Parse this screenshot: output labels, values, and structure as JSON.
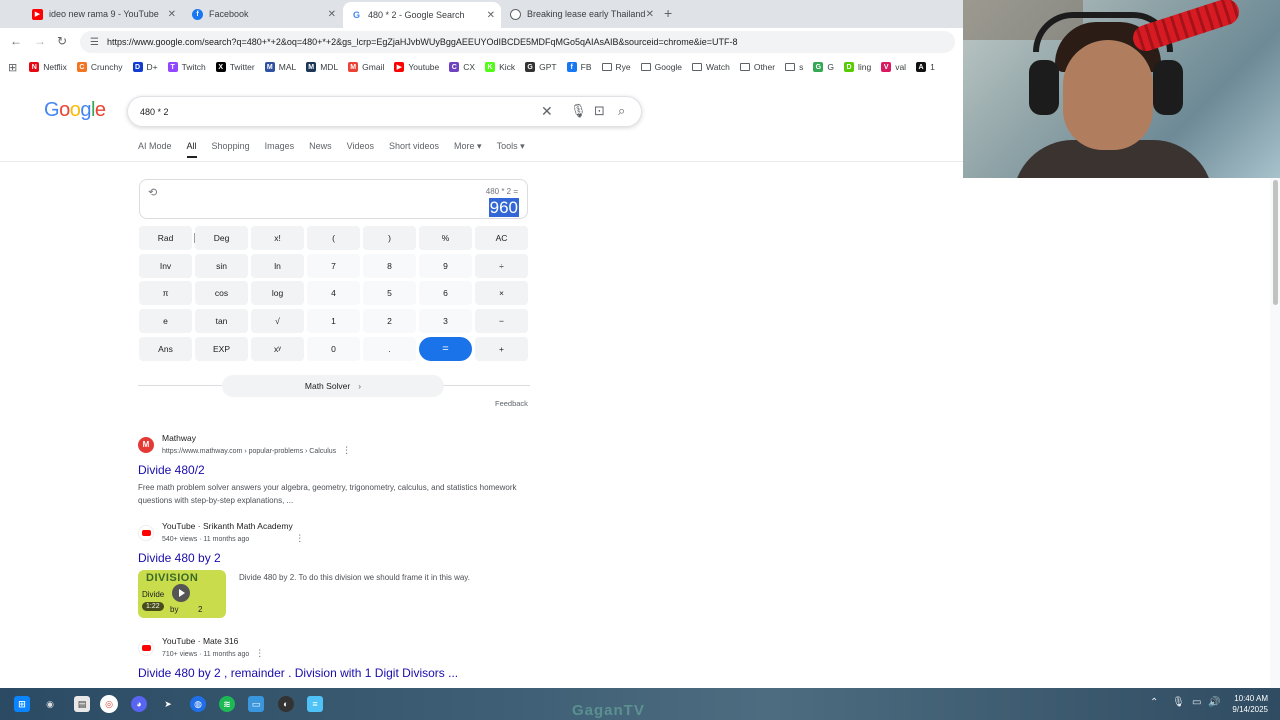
{
  "browser": {
    "tabs": [
      {
        "title": "ideo new rama 9 - YouTube",
        "favicon": "youtube-icon",
        "color": "#ff0000"
      },
      {
        "title": "Facebook",
        "favicon": "facebook-icon",
        "color": "#1877f2"
      },
      {
        "title": "480 * 2 - Google Search",
        "favicon": "google-icon",
        "color": "#4285f4",
        "active": true
      },
      {
        "title": "Breaking lease early Thailand",
        "favicon": "globe-icon",
        "color": "#5f6368"
      }
    ],
    "url": "https://www.google.com/search?q=480+*+2&oq=480+*+2&gs_lcrp=EgZjaHJvbWUyBggAEEUYOdIBCDE5MDFqMGo5qAIAsAIB&sourceid=chrome&ie=UTF-8",
    "bookmarks": [
      {
        "label": "Netflix",
        "color": "#e50914",
        "glyph": "N"
      },
      {
        "label": "Crunchy",
        "color": "#f47521",
        "glyph": "C"
      },
      {
        "label": "D+",
        "color": "#113ccf",
        "glyph": "D"
      },
      {
        "label": "Twitch",
        "color": "#9146ff",
        "glyph": "T"
      },
      {
        "label": "Twitter",
        "color": "#000000",
        "glyph": "X"
      },
      {
        "label": "MAL",
        "color": "#2e51a2",
        "glyph": "M"
      },
      {
        "label": "MDL",
        "color": "#1d3557",
        "glyph": "M"
      },
      {
        "label": "Gmail",
        "color": "#ea4335",
        "glyph": "M"
      },
      {
        "label": "Youtube",
        "color": "#ff0000",
        "glyph": "▶"
      },
      {
        "label": "CX",
        "color": "#6f42c1",
        "glyph": "C"
      },
      {
        "label": "Kick",
        "color": "#53fc18",
        "glyph": "K"
      },
      {
        "label": "GPT",
        "color": "#333333",
        "glyph": "G"
      },
      {
        "label": "FB",
        "color": "#1877f2",
        "glyph": "f"
      },
      {
        "label": "Rye",
        "folder": true
      },
      {
        "label": "Google",
        "folder": true
      },
      {
        "label": "Watch",
        "folder": true
      },
      {
        "label": "Other",
        "folder": true
      },
      {
        "label": "s",
        "folder": true
      },
      {
        "label": "G",
        "color": "#34a853",
        "glyph": "G"
      },
      {
        "label": "ling",
        "color": "#58cc02",
        "glyph": "D"
      },
      {
        "label": "val",
        "color": "#d81b60",
        "glyph": "V"
      },
      {
        "label": "1",
        "color": "#111111",
        "glyph": "A"
      }
    ]
  },
  "search": {
    "query": "480 * 2",
    "tabs": [
      "AI Mode",
      "All",
      "Shopping",
      "Images",
      "News",
      "Videos",
      "Short videos",
      "More",
      "Tools"
    ]
  },
  "calculator": {
    "expression": "480 * 2 =",
    "result": "960",
    "keys": [
      [
        "Rad",
        "Deg",
        "x!",
        "(",
        ")",
        "%",
        "AC"
      ],
      [
        "Inv",
        "sin",
        "ln",
        "7",
        "8",
        "9",
        "÷"
      ],
      [
        "π",
        "cos",
        "log",
        "4",
        "5",
        "6",
        "×"
      ],
      [
        "e",
        "tan",
        "√",
        "1",
        "2",
        "3",
        "−"
      ],
      [
        "Ans",
        "EXP",
        "xʸ",
        "0",
        ".",
        "=",
        "+"
      ]
    ],
    "math_solver": "Math Solver",
    "feedback": "Feedback"
  },
  "results": [
    {
      "source": "Mathway",
      "url": "https://www.mathway.com › popular-problems › Calculus",
      "title": "Divide 480/2",
      "snippet": "Free math problem solver answers your algebra, geometry, trigonometry, calculus, and statistics homework questions with step-by-step explanations, ..."
    },
    {
      "source": "YouTube · Srikanth Math Academy",
      "meta": "540+ views · 11 months ago",
      "title": "Divide 480 by 2",
      "snippet": "Divide 480 by 2. To do this division we should frame it in this way.",
      "thumb_text": "DIVISION",
      "thumb_line1": "Divide",
      "thumb_by": "by",
      "thumb_num": "2",
      "duration": "1:22"
    },
    {
      "source": "YouTube · Mate 316",
      "meta": "710+ views · 11 months ago",
      "title": "Divide 480 by 2 , remainder . Division with 1 Digit Divisors ..."
    }
  ],
  "taskbar": {
    "watermark": "GaganTV",
    "time": "10:40 AM",
    "date": "9/14/2025"
  }
}
